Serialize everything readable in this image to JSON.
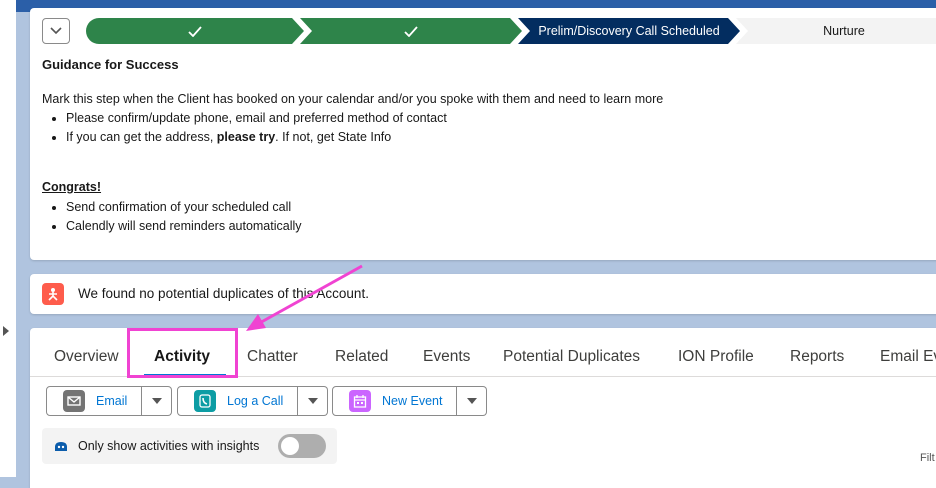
{
  "path": {
    "stages": [
      {
        "label": "",
        "status": "complete"
      },
      {
        "label": "",
        "status": "complete"
      },
      {
        "label": "Prelim/Discovery Call Scheduled",
        "status": "current"
      },
      {
        "label": "Nurture",
        "status": "incomplete"
      }
    ]
  },
  "guidance": {
    "title": "Guidance for Success",
    "intro": "Mark this step when the Client has booked on your calendar and/or you spoke with them and need to learn more",
    "bullet1": "Please confirm/update phone, email and preferred method of contact",
    "bullet2_pre": "If you can get the address, ",
    "bullet2_bold": "please try",
    "bullet2_post": ". If not, get State Info",
    "congrats_title": "Congrats!",
    "congrats_bullet1": "Send confirmation of your scheduled call",
    "congrats_bullet2": "Calendly will send reminders automatically"
  },
  "duplicates": {
    "message": "We found no potential duplicates of this Account."
  },
  "tabs": [
    {
      "label": "Overview"
    },
    {
      "label": "Activity",
      "active": true
    },
    {
      "label": "Chatter"
    },
    {
      "label": "Related"
    },
    {
      "label": "Events"
    },
    {
      "label": "Potential Duplicates"
    },
    {
      "label": "ION Profile"
    },
    {
      "label": "Reports"
    },
    {
      "label": "Email Ev"
    }
  ],
  "actions": {
    "email": "Email",
    "log_call": "Log a Call",
    "new_event": "New Event"
  },
  "insights": {
    "label": "Only show activities with insights",
    "enabled": false
  },
  "filter_text": "Filt",
  "colors": {
    "complete_stage": "#2e844a",
    "current_stage": "#032d60",
    "email_icon": "#747474",
    "call_icon": "#0d9da4",
    "event_icon": "#cb65ff",
    "duplicate_icon": "#fe5c4c",
    "annotation": "#f043d2"
  }
}
